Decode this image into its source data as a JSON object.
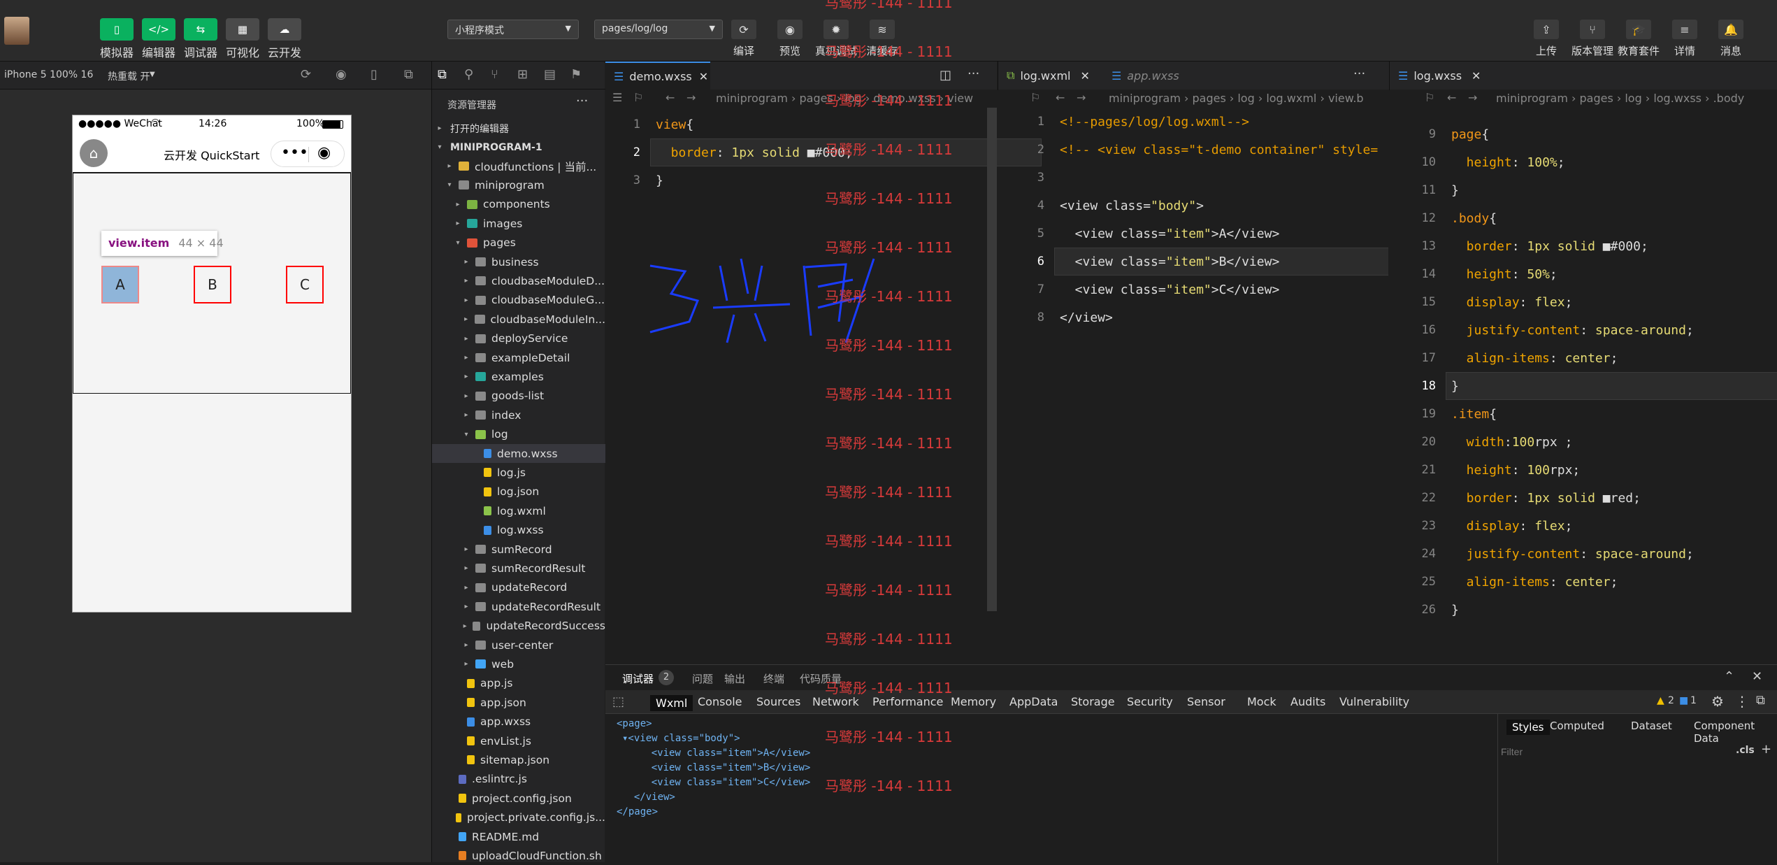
{
  "toolbar": {
    "left_buttons": [
      {
        "label": "模拟器",
        "icon": "phone-icon"
      },
      {
        "label": "编辑器",
        "icon": "code-icon"
      },
      {
        "label": "调试器",
        "icon": "debug-icon"
      },
      {
        "label": "可视化",
        "icon": "layout-icon"
      },
      {
        "label": "云开发",
        "icon": "cloud-icon"
      }
    ],
    "mode_select": "小程序模式",
    "page_select": "pages/log/log",
    "center_buttons": [
      {
        "label": "编译",
        "icon": "refresh-icon"
      },
      {
        "label": "预览",
        "icon": "eye-icon"
      },
      {
        "label": "真机调试",
        "icon": "bug-icon"
      },
      {
        "label": "清缓存",
        "icon": "layers-icon"
      }
    ],
    "right_buttons": [
      {
        "label": "上传",
        "icon": "upload-icon"
      },
      {
        "label": "版本管理",
        "icon": "branch-icon"
      },
      {
        "label": "教育套件",
        "icon": "graduation-icon"
      },
      {
        "label": "详情",
        "icon": "menu-icon"
      },
      {
        "label": "消息",
        "icon": "bell-icon"
      }
    ]
  },
  "simulator": {
    "device": "iPhone 5 100% 16",
    "hot_reload": "热重载 开",
    "status_carrier": "●●●●● WeChat",
    "status_time": "14:26",
    "status_battery": "100%",
    "nav_title": "云开发 QuickStart",
    "tooltip_name": "view.item",
    "tooltip_size": "44 × 44",
    "items": [
      "A",
      "B",
      "C"
    ]
  },
  "explorer": {
    "title": "资源管理器",
    "open_editors": "打开的编辑器",
    "project": "MINIPROGRAM-1",
    "tree": [
      {
        "label": "cloudfunctions | 当前...",
        "depth": 1,
        "type": "folder-cloud",
        "arrow": "▸"
      },
      {
        "label": "miniprogram",
        "depth": 1,
        "type": "folder",
        "arrow": "▾"
      },
      {
        "label": "components",
        "depth": 2,
        "type": "folder-green",
        "arrow": "▸"
      },
      {
        "label": "images",
        "depth": 2,
        "type": "folder-teal",
        "arrow": "▸"
      },
      {
        "label": "pages",
        "depth": 2,
        "type": "folder-red",
        "arrow": "▾"
      },
      {
        "label": "business",
        "depth": 3,
        "type": "folder",
        "arrow": "▸"
      },
      {
        "label": "cloudbaseModuleD...",
        "depth": 3,
        "type": "folder",
        "arrow": "▸"
      },
      {
        "label": "cloudbaseModuleG...",
        "depth": 3,
        "type": "folder",
        "arrow": "▸"
      },
      {
        "label": "cloudbaseModuleIn...",
        "depth": 3,
        "type": "folder",
        "arrow": "▸"
      },
      {
        "label": "deployService",
        "depth": 3,
        "type": "folder",
        "arrow": "▸"
      },
      {
        "label": "exampleDetail",
        "depth": 3,
        "type": "folder",
        "arrow": "▸"
      },
      {
        "label": "examples",
        "depth": 3,
        "type": "folder-teal",
        "arrow": "▸"
      },
      {
        "label": "goods-list",
        "depth": 3,
        "type": "folder",
        "arrow": "▸"
      },
      {
        "label": "index",
        "depth": 3,
        "type": "folder",
        "arrow": "▸"
      },
      {
        "label": "log",
        "depth": 3,
        "type": "folder-open",
        "arrow": "▾"
      },
      {
        "label": "demo.wxss",
        "depth": 4,
        "type": "file-wxss",
        "arrow": ""
      },
      {
        "label": "log.js",
        "depth": 4,
        "type": "file-js",
        "arrow": ""
      },
      {
        "label": "log.json",
        "depth": 4,
        "type": "file-json",
        "arrow": ""
      },
      {
        "label": "log.wxml",
        "depth": 4,
        "type": "file-wxml",
        "arrow": ""
      },
      {
        "label": "log.wxss",
        "depth": 4,
        "type": "file-wxss",
        "arrow": ""
      },
      {
        "label": "sumRecord",
        "depth": 3,
        "type": "folder",
        "arrow": "▸"
      },
      {
        "label": "sumRecordResult",
        "depth": 3,
        "type": "folder",
        "arrow": "▸"
      },
      {
        "label": "updateRecord",
        "depth": 3,
        "type": "folder",
        "arrow": "▸"
      },
      {
        "label": "updateRecordResult",
        "depth": 3,
        "type": "folder",
        "arrow": "▸"
      },
      {
        "label": "updateRecordSuccess",
        "depth": 3,
        "type": "folder",
        "arrow": "▸"
      },
      {
        "label": "user-center",
        "depth": 3,
        "type": "folder",
        "arrow": "▸"
      },
      {
        "label": "web",
        "depth": 3,
        "type": "folder-blue",
        "arrow": "▸"
      },
      {
        "label": "app.js",
        "depth": 2,
        "type": "file-js",
        "arrow": ""
      },
      {
        "label": "app.json",
        "depth": 2,
        "type": "file-json",
        "arrow": ""
      },
      {
        "label": "app.wxss",
        "depth": 2,
        "type": "file-wxss",
        "arrow": ""
      },
      {
        "label": "envList.js",
        "depth": 2,
        "type": "file-js",
        "arrow": ""
      },
      {
        "label": "sitemap.json",
        "depth": 2,
        "type": "file-json",
        "arrow": ""
      },
      {
        "label": ".eslintrc.js",
        "depth": 1,
        "type": "file-eslint",
        "arrow": ""
      },
      {
        "label": "project.config.json",
        "depth": 1,
        "type": "file-json",
        "arrow": ""
      },
      {
        "label": "project.private.config.js...",
        "depth": 1,
        "type": "file-json",
        "arrow": ""
      },
      {
        "label": "README.md",
        "depth": 1,
        "type": "file-md",
        "arrow": ""
      },
      {
        "label": "uploadCloudFunction.sh",
        "depth": 1,
        "type": "file-sh",
        "arrow": ""
      }
    ]
  },
  "editor1": {
    "tab": "demo.wxss",
    "breadcrumb": "miniprogram › pages › log › demo.wxss › view",
    "lines": [
      {
        "n": "1",
        "parts": [
          [
            "k",
            "view"
          ],
          [
            "c",
            "{"
          ]
        ]
      },
      {
        "n": "2",
        "parts": [
          [
            "p",
            "  border"
          ],
          [
            "c",
            ": "
          ],
          [
            "s",
            "1px solid "
          ],
          [
            "c",
            "■#000;"
          ]
        ]
      },
      {
        "n": "3",
        "parts": [
          [
            "c",
            "}"
          ]
        ]
      }
    ]
  },
  "editor2": {
    "tabs": [
      "log.wxml",
      "app.wxss"
    ],
    "breadcrumb": "miniprogram › pages › log › log.wxml › view.b",
    "lines": [
      {
        "n": "1",
        "parts": [
          [
            "cmt",
            "<!--pages/log/log.wxml-->"
          ]
        ]
      },
      {
        "n": "2",
        "parts": [
          [
            "cmt",
            "<!-- <view class=\"t-demo container\" style="
          ]
        ]
      },
      {
        "n": "3",
        "parts": [
          [
            "c",
            ""
          ]
        ]
      },
      {
        "n": "4",
        "parts": [
          [
            "tag",
            "<view class="
          ],
          [
            "s",
            "\"body\""
          ],
          [
            "tag",
            ">"
          ]
        ]
      },
      {
        "n": "5",
        "parts": [
          [
            "tag",
            "  <view class="
          ],
          [
            "s",
            "\"item\""
          ],
          [
            "tag",
            ">A</view>"
          ]
        ]
      },
      {
        "n": "6",
        "parts": [
          [
            "tag",
            "  <view class="
          ],
          [
            "s",
            "\"item\""
          ],
          [
            "tag",
            ">B</view>"
          ]
        ]
      },
      {
        "n": "7",
        "parts": [
          [
            "tag",
            "  <view class="
          ],
          [
            "s",
            "\"item\""
          ],
          [
            "tag",
            ">C</view>"
          ]
        ]
      },
      {
        "n": "8",
        "parts": [
          [
            "tag",
            "</view>"
          ]
        ]
      }
    ]
  },
  "editor3": {
    "tab": "log.wxss",
    "breadcrumb": "miniprogram › pages › log › log.wxss › .body",
    "lines": [
      {
        "n": "9",
        "parts": [
          [
            "k",
            "page"
          ],
          [
            "c",
            "{"
          ]
        ]
      },
      {
        "n": "10",
        "parts": [
          [
            "p",
            "  height"
          ],
          [
            "c",
            ": "
          ],
          [
            "s",
            "100%"
          ],
          [
            "c",
            ";"
          ]
        ]
      },
      {
        "n": "11",
        "parts": [
          [
            "c",
            "}"
          ]
        ]
      },
      {
        "n": "12",
        "parts": [
          [
            "k",
            ".body"
          ],
          [
            "c",
            "{"
          ]
        ]
      },
      {
        "n": "13",
        "parts": [
          [
            "p",
            "  border"
          ],
          [
            "c",
            ": "
          ],
          [
            "s",
            "1px solid "
          ],
          [
            "c",
            "■#000;"
          ]
        ]
      },
      {
        "n": "14",
        "parts": [
          [
            "p",
            "  height"
          ],
          [
            "c",
            ": "
          ],
          [
            "s",
            "50%"
          ],
          [
            "c",
            ";"
          ]
        ]
      },
      {
        "n": "15",
        "parts": [
          [
            "p",
            "  display"
          ],
          [
            "c",
            ": "
          ],
          [
            "s",
            "flex"
          ],
          [
            "c",
            ";"
          ]
        ]
      },
      {
        "n": "16",
        "parts": [
          [
            "p",
            "  justify-content"
          ],
          [
            "c",
            ": "
          ],
          [
            "s",
            "space-around"
          ],
          [
            "c",
            ";"
          ]
        ]
      },
      {
        "n": "17",
        "parts": [
          [
            "p",
            "  align-items"
          ],
          [
            "c",
            ": "
          ],
          [
            "s",
            "center"
          ],
          [
            "c",
            ";"
          ]
        ]
      },
      {
        "n": "18",
        "parts": [
          [
            "c",
            "}"
          ]
        ]
      },
      {
        "n": "19",
        "parts": [
          [
            "k",
            ".item"
          ],
          [
            "c",
            "{"
          ]
        ]
      },
      {
        "n": "20",
        "parts": [
          [
            "p",
            "  width"
          ],
          [
            "c",
            ":"
          ],
          [
            "s",
            "100"
          ],
          [
            "c",
            "rpx ;"
          ]
        ]
      },
      {
        "n": "21",
        "parts": [
          [
            "p",
            "  height"
          ],
          [
            "c",
            ": "
          ],
          [
            "s",
            "100"
          ],
          [
            "c",
            "rpx;"
          ]
        ]
      },
      {
        "n": "22",
        "parts": [
          [
            "p",
            "  border"
          ],
          [
            "c",
            ": "
          ],
          [
            "s",
            "1px solid "
          ],
          [
            "c",
            "■red;"
          ]
        ]
      },
      {
        "n": "23",
        "parts": [
          [
            "p",
            "  display"
          ],
          [
            "c",
            ": "
          ],
          [
            "s",
            "flex"
          ],
          [
            "c",
            ";"
          ]
        ]
      },
      {
        "n": "24",
        "parts": [
          [
            "p",
            "  justify-content"
          ],
          [
            "c",
            ": "
          ],
          [
            "s",
            "space-around"
          ],
          [
            "c",
            ";"
          ]
        ]
      },
      {
        "n": "25",
        "parts": [
          [
            "p",
            "  align-items"
          ],
          [
            "c",
            ": "
          ],
          [
            "s",
            "center"
          ],
          [
            "c",
            ";"
          ]
        ]
      },
      {
        "n": "26",
        "parts": [
          [
            "c",
            "}"
          ]
        ]
      }
    ]
  },
  "devtools": {
    "panel_tabs": [
      "调试器",
      "问题",
      "输出",
      "终端",
      "代码质量"
    ],
    "debugger_badge": "2",
    "tabs": [
      "Wxml",
      "Console",
      "Sources",
      "Network",
      "Performance",
      "Memory",
      "AppData",
      "Storage",
      "Security",
      "Sensor",
      "Mock",
      "Audits",
      "Vulnerability"
    ],
    "warn_count": "2",
    "info_count": "1",
    "wxml_tree": [
      "<page>",
      "▾<view class=\"body\">",
      "    <view class=\"item\">A</view>",
      "    <view class=\"item\">B</view>",
      "    <view class=\"item\">C</view>",
      "  </view>",
      "</page>"
    ],
    "style_tabs": [
      "Styles",
      "Computed",
      "Dataset",
      "Component Data"
    ],
    "filter_placeholder": "Filter",
    "cls": ".cls"
  },
  "watermark": "马鹭彤 -144 - 1111"
}
